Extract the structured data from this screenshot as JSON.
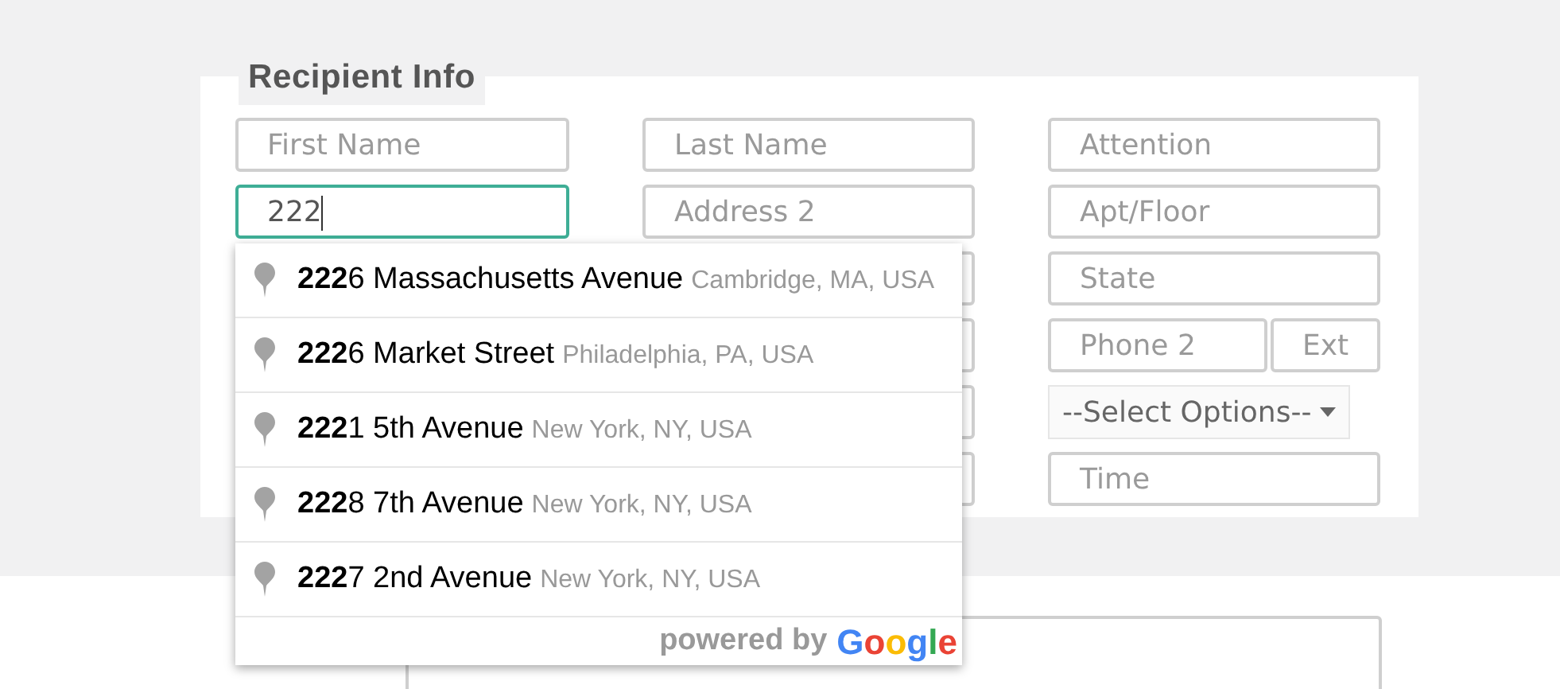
{
  "section": {
    "title": "Recipient Info"
  },
  "fields": [
    {
      "kind": "input",
      "placeholder": "First Name",
      "focused": false
    },
    {
      "kind": "input",
      "placeholder": "Last Name",
      "focused": false
    },
    {
      "kind": "input",
      "placeholder": "Attention",
      "focused": false
    },
    {
      "kind": "input",
      "value": "222",
      "focused": true
    },
    {
      "kind": "input",
      "placeholder": "Address 2",
      "focused": false
    },
    {
      "kind": "input",
      "placeholder": "Apt/Floor",
      "focused": false
    },
    {
      "kind": "hidden"
    },
    {
      "kind": "hidden"
    },
    {
      "kind": "input",
      "placeholder": "State",
      "focused": false
    },
    {
      "kind": "hidden"
    },
    {
      "kind": "hidden"
    },
    {
      "kind": "phone",
      "placeholder": "Phone 2",
      "ext": "Ext",
      "focused": false
    },
    {
      "kind": "hidden"
    },
    {
      "kind": "hidden"
    },
    {
      "kind": "select",
      "value": "--Select Options--"
    },
    {
      "kind": "hidden"
    },
    {
      "kind": "hidden"
    },
    {
      "kind": "input",
      "placeholder": "Time",
      "focused": false
    }
  ],
  "suggestions": [
    {
      "main": "**222**6 Massachusetts Avenue",
      "secondary": "Cambridge, MA, USA"
    },
    {
      "main": "**222**6 Market Street",
      "secondary": "Philadelphia, PA, USA"
    },
    {
      "main": "**222**1 5th Avenue",
      "secondary": "New York, NY, USA"
    },
    {
      "main": "**222**8 7th Avenue",
      "secondary": "New York, NY, USA"
    },
    {
      "main": "**222**7 2nd Avenue",
      "secondary": "New York, NY, USA"
    }
  ],
  "attribution": {
    "text": "powered by",
    "brand": "Google"
  }
}
